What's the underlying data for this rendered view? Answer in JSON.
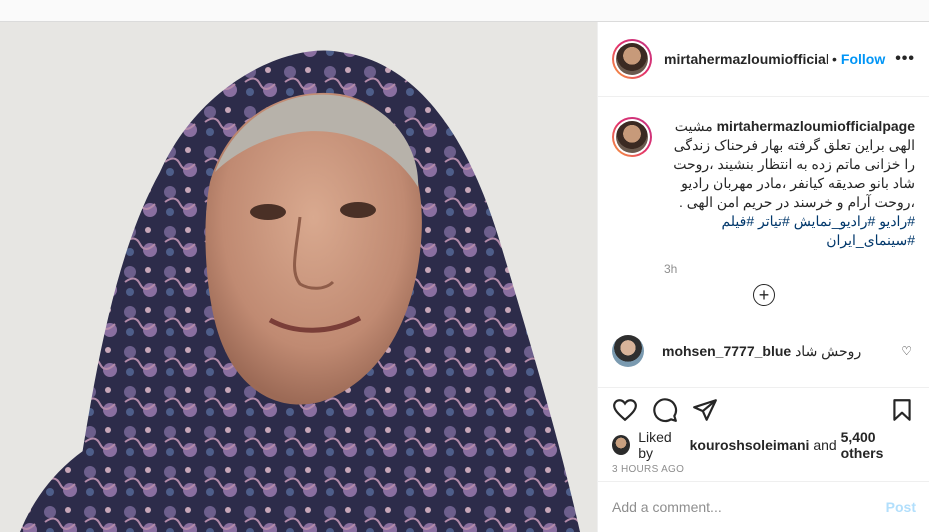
{
  "post": {
    "photo_alt": "Portrait photo",
    "header": {
      "username": "mirtahermazloumiofficialpage",
      "username_visible": "mirtahermazloumiofficialp",
      "dot": "•",
      "follow_label": "Follow",
      "more_label": "•••"
    },
    "caption": {
      "username": "mirtahermazloumiofficialpage",
      "text": "مشیت الهی براین تعلق گرفته بهار فرحناک زندگی را خزانی ماتم زده به انتظار بنشیند ،روحت شاد بانو صدیقه کیانفر ،مادر مهربان رادیو ،روحت آرام و خرسند در حریم امن الهی .",
      "hashtags": "#رادیو #رادیو_نمایش #تیاتر #فیلم #سینمای_ایران",
      "time": "3h"
    },
    "load_more_icon": "plus-circle-icon",
    "load_more_label": "+",
    "comment": {
      "username": "mohsen_7777_blue",
      "text": "روحش شاد",
      "heart_icon": "heart-icon",
      "heart_glyph": "♡"
    },
    "actions": {
      "like_icon": "heart-icon",
      "comment_icon": "comment-icon",
      "share_icon": "paper-plane-icon",
      "save_icon": "bookmark-icon"
    },
    "likes": {
      "prefix": "Liked by",
      "user": "kouroshsoleimani",
      "and": "and",
      "others": "5,400 others"
    },
    "timestamp": "3 HOURS AGO",
    "add_comment": {
      "placeholder": "Add a comment...",
      "post_label": "Post"
    }
  },
  "colors": {
    "accent": "#0095f6",
    "hashtag": "#00376b",
    "muted": "#8e8e8e",
    "post_disabled": "#b2dffc"
  }
}
